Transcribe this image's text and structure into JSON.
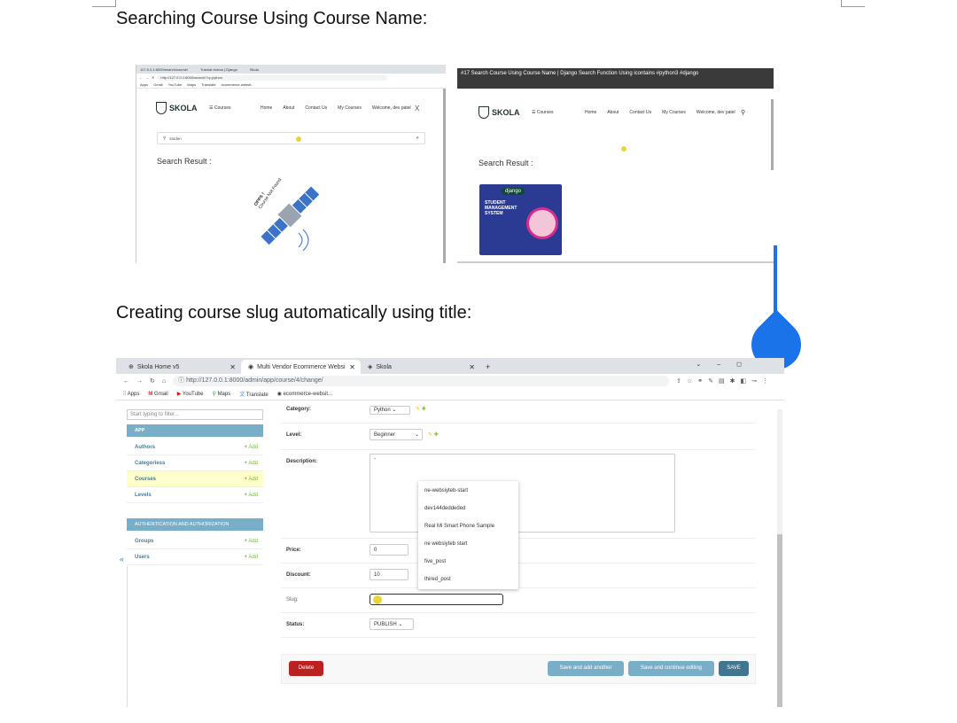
{
  "doc": {
    "heading1": "Searching Course Using Course Name:",
    "heading2": "Creating course slug automatically using title:"
  },
  "shot1": {
    "tab1": "127.0.0.1:8000/search/course/",
    "tab2": "Tutorial videos | Django",
    "tab3": "Skola",
    "url": "http://127.0.0.1:8000/search/?q=python",
    "bookmarks": [
      "Apps",
      "Gmail",
      "YouTube",
      "Maps",
      "Translate",
      "ecommerce-websit..."
    ],
    "logo": "SKOLA",
    "menu": "Courses",
    "nav": [
      "Home",
      "About",
      "Contact Us",
      "My Courses",
      "Welcome, dev patel"
    ],
    "close": "X",
    "search_value": "studen",
    "search_result": "Search Result :",
    "not_found_1": "OPPS !",
    "not_found_2": "Course Not Found"
  },
  "shot2": {
    "title": "#17 Search Course Using Course Name | Django Search Function Using icontains #python3 #django",
    "logo": "SKOLA",
    "menu": "Courses",
    "nav": [
      "Home",
      "About",
      "Contact Us",
      "My Courses",
      "Welcome, dev patel"
    ],
    "search_result": "Search Result :",
    "card_brand": "django",
    "card_title": "STUDENT MANAGEMENT SYSTEM"
  },
  "shot3": {
    "tabs": [
      "Skola Home v5",
      "Multi Vendor Ecommerce Websi",
      "Skola"
    ],
    "url": "http://127.0.0.1:8000/admin/app/course/4/change/",
    "bookmarks": [
      "Apps",
      "Gmail",
      "YouTube",
      "Maps",
      "Translate",
      "ecommerce-websit..."
    ],
    "filter_placeholder": "Start typing to filter...",
    "app_header": "APP",
    "app_items": [
      "Authors",
      "Categoriess",
      "Courses",
      "Levels"
    ],
    "auth_header": "AUTHENTICATION AND AUTHORIZATION",
    "auth_items": [
      "Groups",
      "Users"
    ],
    "add": "Add",
    "collapse": "«",
    "fields": {
      "category_label": "Category:",
      "category_value": "Python",
      "level_label": "Level:",
      "level_value": "Beginner",
      "description_label": "Description:",
      "description_value": "-",
      "price_label": "Price:",
      "price_value": "0",
      "discount_label": "Discount:",
      "discount_value": "10",
      "slug_label": "Slug:",
      "status_label": "Status:",
      "status_value": "PUBLISH"
    },
    "suggestions": [
      "ne-websiyteb-start",
      "dev144deddeded",
      "Real Mi Smart Phone Sample",
      "ne websiyteb start",
      "five_post",
      "thired_post"
    ],
    "buttons": {
      "delete": "Delete",
      "save_add": "Save and add another",
      "save_continue": "Save and continue editing",
      "save": "SAVE"
    }
  },
  "colors": {
    "django_header": "#79aec8",
    "link": "#447e9b",
    "delete": "#ba2121",
    "save": "#417690",
    "save_alt": "#79aec8",
    "marker": "#1a73e8"
  }
}
